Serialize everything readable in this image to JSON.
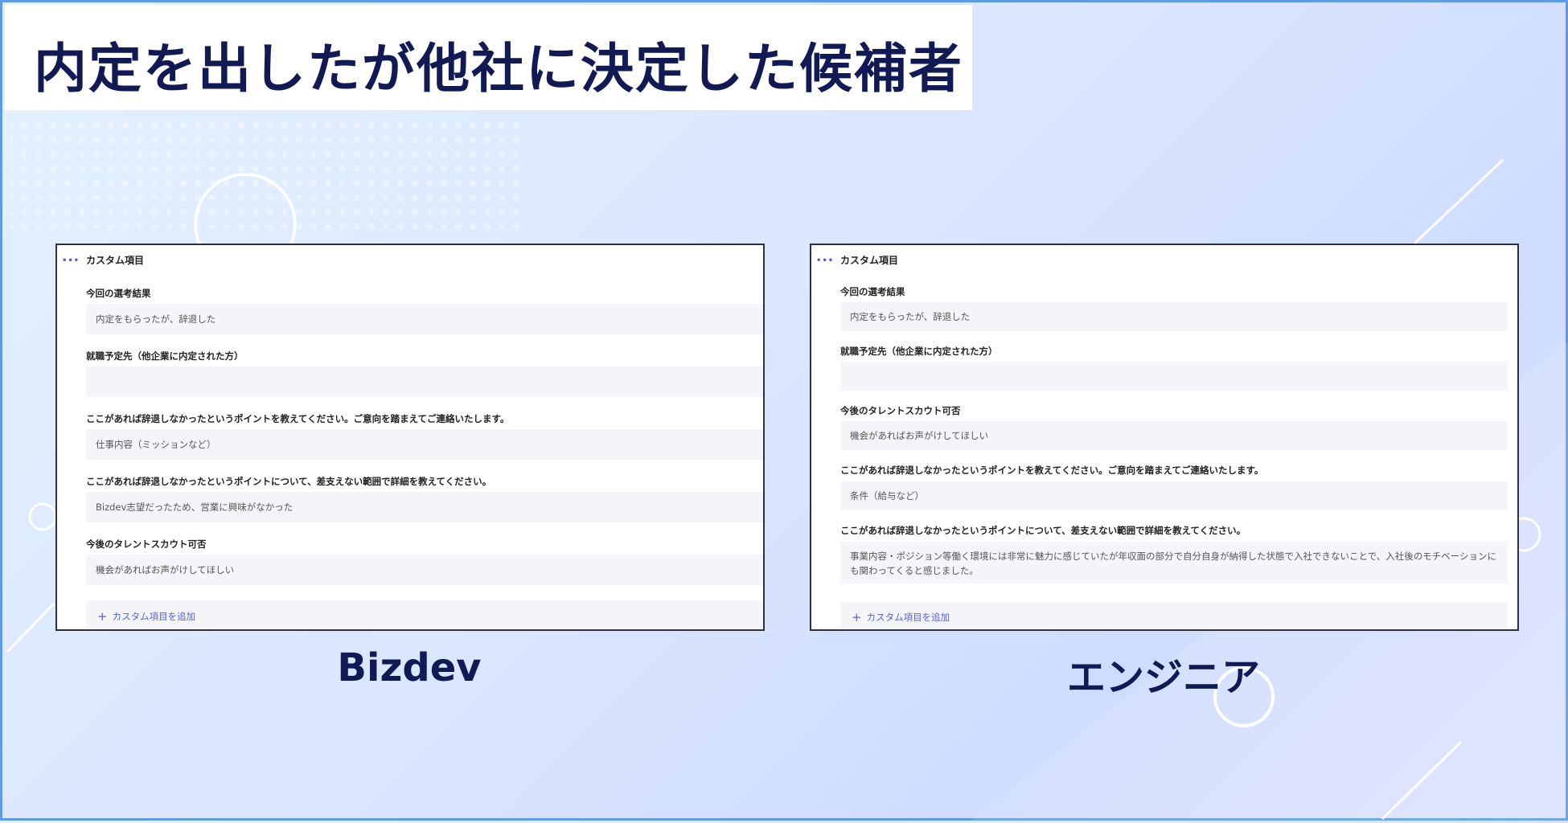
{
  "title": "内定を出したが他社に決定した候補者",
  "colors": {
    "title_text": "#121a56",
    "accent": "#5b5fd6",
    "border": "#5d9ae8"
  },
  "left_panel": {
    "header": "カスタム項目",
    "fields": [
      {
        "label": "今回の選考結果",
        "value": "内定をもらったが、辞退した"
      },
      {
        "label": "就職予定先（他企業に内定された方）",
        "value": ""
      },
      {
        "label": "ここがあれば辞退しなかったというポイントを教えてください。ご意向を踏まえてご連絡いたします。",
        "value": "仕事内容（ミッションなど）"
      },
      {
        "label": "ここがあれば辞退しなかったというポイントについて、差支えない範囲で詳細を教えてください。",
        "value": "Bizdev志望だったため、営業に興味がなかった"
      },
      {
        "label": "今後のタレントスカウト可否",
        "value": "機会があればお声がけしてほしい"
      }
    ],
    "add_label": "カスタム項目を追加",
    "caption": "Bizdev"
  },
  "right_panel": {
    "header": "カスタム項目",
    "fields": [
      {
        "label": "今回の選考結果",
        "value": "内定をもらったが、辞退した"
      },
      {
        "label": "就職予定先（他企業に内定された方）",
        "value": ""
      },
      {
        "label": "今後のタレントスカウト可否",
        "value": "機会があればお声がけしてほしい"
      },
      {
        "label": "ここがあれば辞退しなかったというポイントを教えてください。ご意向を踏まえてご連絡いたします。",
        "value": "条件（給与など）"
      },
      {
        "label": "ここがあれば辞退しなかったというポイントについて、差支えない範囲で詳細を教えてください。",
        "value": "事業内容・ポジション等働く環境には非常に魅力に感じていたが年収面の部分で自分自身が納得した状態で入社できないことで、入社後のモチベーションにも関わってくると感じました。"
      }
    ],
    "add_label": "カスタム項目を追加",
    "caption": "エンジニア"
  }
}
